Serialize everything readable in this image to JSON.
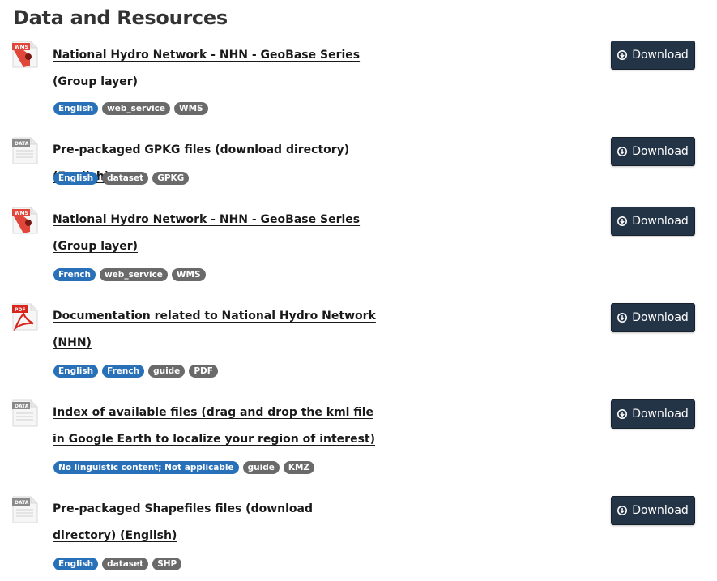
{
  "section": {
    "title": "Data and Resources"
  },
  "resources": [
    {
      "format_icon": "wms-file-icon",
      "title": "National Hydro Network - NHN - GeoBase Series (Group layer)",
      "badges": [
        {
          "label": "English",
          "kind": "language"
        },
        {
          "label": "web_service",
          "kind": "type"
        },
        {
          "label": "WMS",
          "kind": "format"
        }
      ],
      "download_label": "Download"
    },
    {
      "format_icon": "data-file-icon",
      "title": "Pre-packaged GPKG files (download directory) (English)",
      "badges": [
        {
          "label": "English",
          "kind": "language"
        },
        {
          "label": "dataset",
          "kind": "type"
        },
        {
          "label": "GPKG",
          "kind": "format"
        }
      ],
      "download_label": "Download"
    },
    {
      "format_icon": "wms-file-icon",
      "title": "National Hydro Network - NHN - GeoBase Series (Group layer)",
      "badges": [
        {
          "label": "French",
          "kind": "language"
        },
        {
          "label": "web_service",
          "kind": "type"
        },
        {
          "label": "WMS",
          "kind": "format"
        }
      ],
      "download_label": "Download"
    },
    {
      "format_icon": "pdf-file-icon",
      "title": "Documentation related to National Hydro Network (NHN)",
      "badges": [
        {
          "label": "English",
          "kind": "language"
        },
        {
          "label": "French",
          "kind": "language"
        },
        {
          "label": "guide",
          "kind": "type"
        },
        {
          "label": "PDF",
          "kind": "format"
        }
      ],
      "download_label": "Download"
    },
    {
      "format_icon": "data-file-icon",
      "title": "Index of available files (drag and drop the kml file in Google Earth to localize your region of interest)",
      "badges": [
        {
          "label": "No linguistic content; Not applicable",
          "kind": "language"
        },
        {
          "label": "guide",
          "kind": "type"
        },
        {
          "label": "KMZ",
          "kind": "format"
        }
      ],
      "download_label": "Download"
    },
    {
      "format_icon": "data-file-icon",
      "title": "Pre-packaged Shapefiles files (download directory) (English)",
      "badges": [
        {
          "label": "English",
          "kind": "language"
        },
        {
          "label": "dataset",
          "kind": "type"
        },
        {
          "label": "SHP",
          "kind": "format"
        }
      ],
      "download_label": "Download"
    }
  ],
  "icon_labels": {
    "wms": "WMS",
    "data": "DATA",
    "pdf": "PDF"
  },
  "colors": {
    "language_badge": "#2870b8",
    "other_badge": "#6a6a6a",
    "download_button": "#243447",
    "wms_icon": "#e0463a",
    "pdf_icon": "#d8261c",
    "data_icon": "#8a8a8a"
  }
}
